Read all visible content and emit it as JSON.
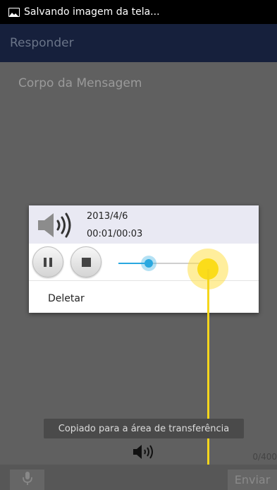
{
  "status_bar": {
    "text": "Salvando imagem da tela..."
  },
  "header": {
    "title": "Responder"
  },
  "compose": {
    "body_placeholder": "Corpo da Mensagem"
  },
  "player": {
    "date": "2013/4/6",
    "time": "00:01/00:03",
    "progress_fraction": 0.33,
    "delete_label": "Deletar"
  },
  "toast": {
    "text": "Copiado para a área de transferência"
  },
  "counter": {
    "text": "0/400"
  },
  "bottom_bar": {
    "send_label": "Enviar"
  },
  "colors": {
    "header_bg": "#16203c",
    "seek_accent": "#29a8e0",
    "touch_indicator": "#fbdc1a"
  }
}
